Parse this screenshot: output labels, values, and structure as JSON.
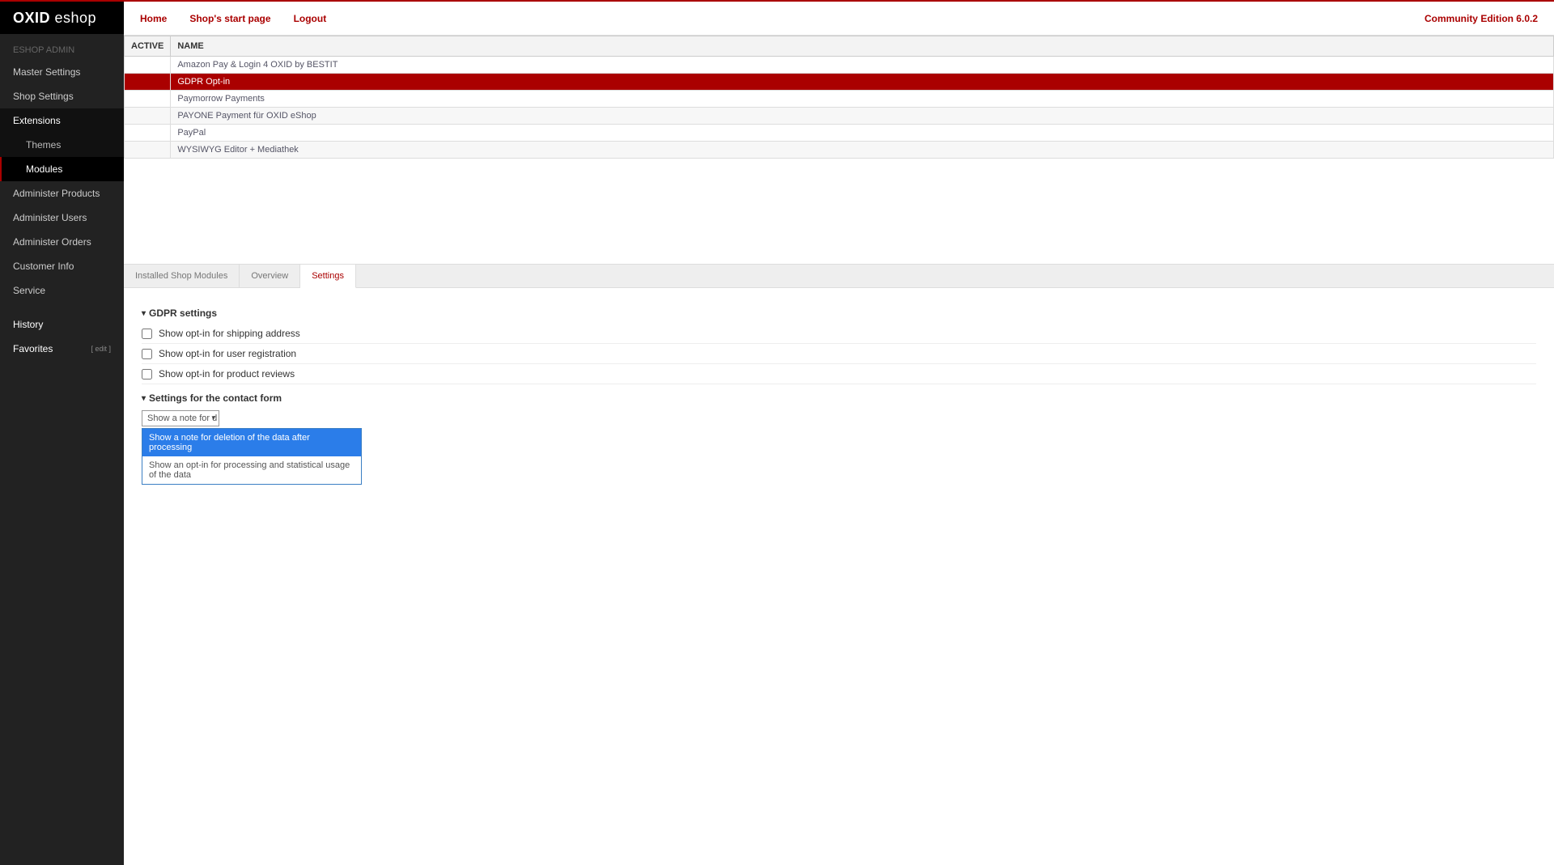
{
  "logo": {
    "bold": "OXID",
    "light": " eshop"
  },
  "sidebar": {
    "admin_label": "ESHOP ADMIN",
    "items": {
      "master_settings": "Master Settings",
      "shop_settings": "Shop Settings",
      "extensions": "Extensions",
      "themes": "Themes",
      "modules": "Modules",
      "admin_products": "Administer Products",
      "admin_users": "Administer Users",
      "admin_orders": "Administer Orders",
      "customer_info": "Customer Info",
      "service": "Service",
      "history": "History",
      "favorites": "Favorites",
      "edit": "[ edit ]"
    }
  },
  "topnav": {
    "home": "Home",
    "start": "Shop's start page",
    "logout": "Logout",
    "edition": "Community Edition 6.0.2"
  },
  "table": {
    "headers": {
      "active": "ACTIVE",
      "name": "NAME"
    },
    "rows": [
      {
        "name": "Amazon Pay & Login 4 OXID by BESTIT",
        "selected": false
      },
      {
        "name": "GDPR Opt-in",
        "selected": true
      },
      {
        "name": "Paymorrow Payments",
        "selected": false
      },
      {
        "name": "PAYONE Payment für OXID eShop",
        "selected": false
      },
      {
        "name": "PayPal",
        "selected": false
      },
      {
        "name": "WYSIWYG Editor + Mediathek",
        "selected": false
      }
    ]
  },
  "tabs": {
    "installed": "Installed Shop Modules",
    "overview": "Overview",
    "settings": "Settings"
  },
  "settings": {
    "group1_title": "GDPR settings",
    "opt1": "Show opt-in for shipping address",
    "opt2": "Show opt-in for user registration",
    "opt3": "Show opt-in for product reviews",
    "group2_title": "Settings for the contact form",
    "select_visible": "Show a note for d",
    "dropdown": {
      "opt1": "Show a note for deletion of the data after processing",
      "opt2": "Show an opt-in for processing and statistical usage of the data"
    }
  }
}
